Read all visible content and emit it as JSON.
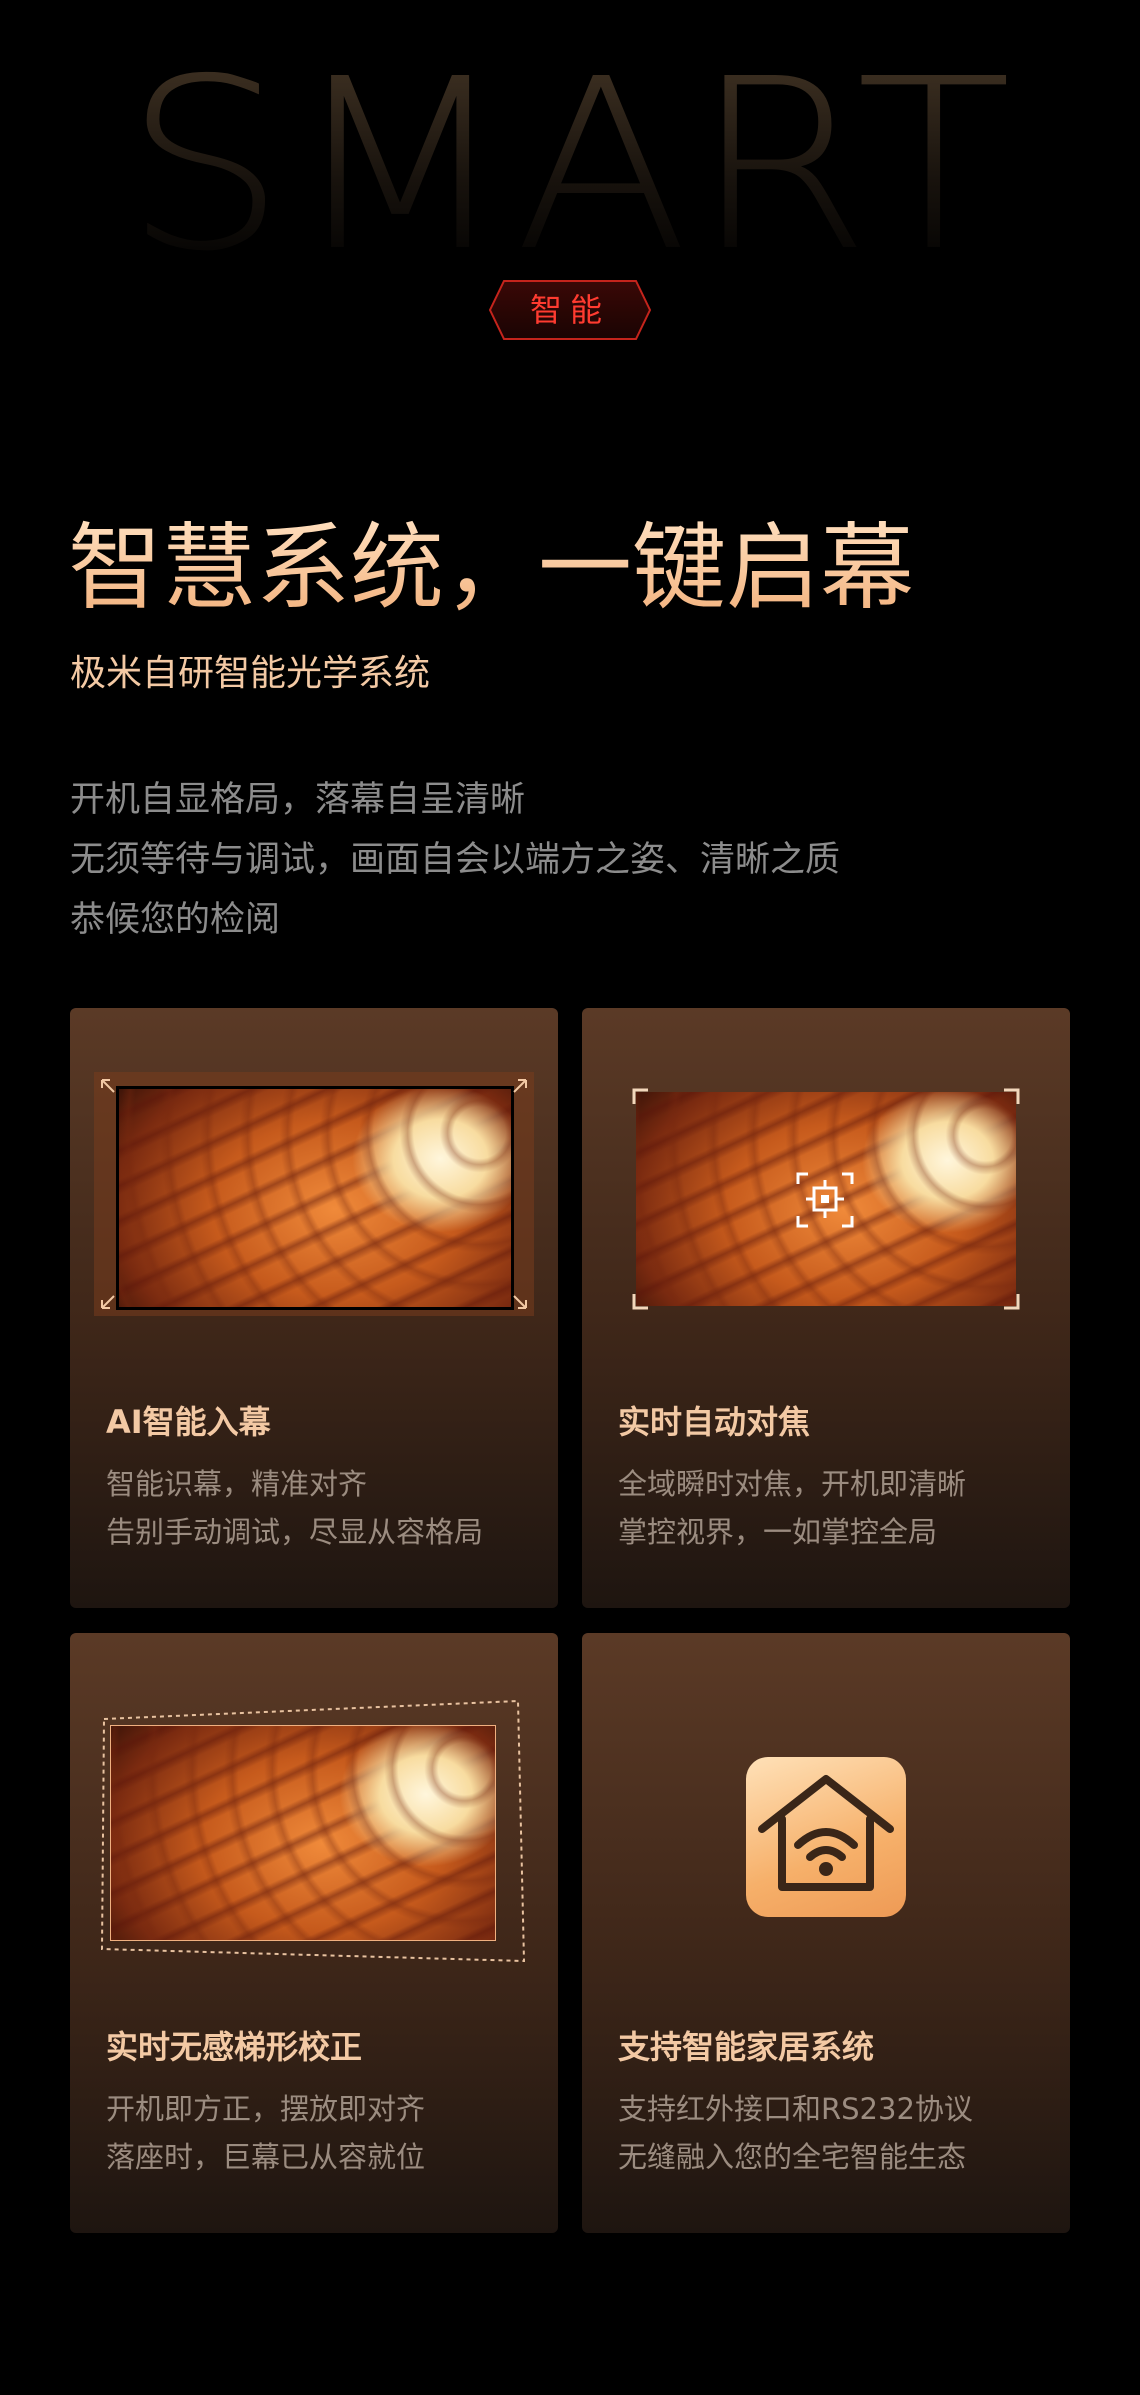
{
  "hero": {
    "bg_word": "SMART",
    "tag": "智能"
  },
  "section": {
    "headline": "智慧系统，一键启幕",
    "subheadline": "极米自研智能光学系统",
    "description": [
      "开机自显格局，落幕自呈清晰",
      "无须等待与调试，画面自会以端方之姿、清晰之质",
      "恭候您的检阅"
    ]
  },
  "features": [
    {
      "title": "AI智能入幕",
      "lines": [
        "智能识幕，精准对齐",
        "告别手动调试，尽显从容格局"
      ],
      "icon": "screen-fit-icon"
    },
    {
      "title": "实时自动对焦",
      "lines": [
        "全域瞬时对焦，开机即清晰",
        "掌控视界，一如掌控全局"
      ],
      "icon": "focus-icon"
    },
    {
      "title": "实时无感梯形校正",
      "lines": [
        "开机即方正，摆放即对齐",
        "落座时，巨幕已从容就位"
      ],
      "icon": "keystone-icon"
    },
    {
      "title": "支持智能家居系统",
      "lines": [
        "支持红外接口和RS232协议",
        "无缝融入您的全宅智能生态"
      ],
      "icon": "smart-home-wifi-icon"
    }
  ],
  "colors": {
    "accent": "#f3c9a4",
    "tag_red": "#ff3b30",
    "body_text": "#8c8c8c",
    "card_top": "#5b3a26",
    "card_bottom": "#1e1510"
  }
}
